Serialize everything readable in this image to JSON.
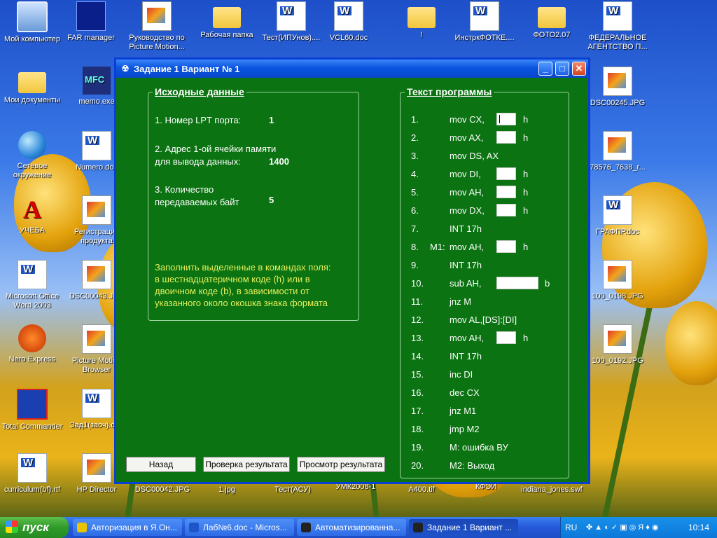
{
  "desktop_icons": [
    {
      "label": "Мой компьютер",
      "icon": "computer-icon"
    },
    {
      "label": "FAR manager",
      "icon": "far-manager-icon"
    },
    {
      "label": "Руководство по Picture Motion...",
      "icon": "picture-motion-icon"
    },
    {
      "label": "Рабочая папка",
      "icon": "folder-icon"
    },
    {
      "label": "Тест(ИПУнов)....",
      "icon": "word-doc-icon"
    },
    {
      "label": "VCL60.doc",
      "icon": "word-doc-icon"
    },
    {
      "label": "!",
      "icon": "folder-icon"
    },
    {
      "label": "ИнстркФОТКЕ....",
      "icon": "word-doc-icon"
    },
    {
      "label": "ФОТО2.07",
      "icon": "folder-icon"
    },
    {
      "label": "ФЕДЕРАЛЬНОЕ АГЕНТСТВО П...",
      "icon": "word-doc-icon"
    },
    {
      "label": "Мои документы",
      "icon": "my-documents-icon"
    },
    {
      "label": "memo.exe",
      "icon": "memo-exe-icon"
    },
    {
      "label": "Сетевое окружение",
      "icon": "network-icon"
    },
    {
      "label": "Numero.doc",
      "icon": "word-doc-icon"
    },
    {
      "label": "УЧЕБА",
      "icon": "acrobat-icon"
    },
    {
      "label": "Регистрация продукта",
      "icon": "camera-icon"
    },
    {
      "label": "Microsoft Office Word 2003",
      "icon": "word-app-icon"
    },
    {
      "label": "DSC00043.JPG",
      "icon": "image-file-icon"
    },
    {
      "label": "Nero Express",
      "icon": "nero-icon"
    },
    {
      "label": "Picture Motion Browser",
      "icon": "picture-browser-icon"
    },
    {
      "label": "Total Commander",
      "icon": "floppy-icon"
    },
    {
      "label": "Зад1(заоч).doc",
      "icon": "word-doc-icon"
    },
    {
      "label": "curriculum(bf).rtf",
      "icon": "word-doc-icon"
    },
    {
      "label": "HP Director",
      "icon": "hp-director-icon"
    },
    {
      "label": "DSC00042.JPG",
      "icon": "image-file-icon"
    },
    {
      "label": "1.jpg",
      "icon": "image-file-icon"
    },
    {
      "label": "Тест(АСУ)",
      "icon": "word-doc-icon"
    },
    {
      "label": "УМК2008-1",
      "icon": "folder-icon"
    },
    {
      "label": "A400.tif",
      "icon": "image-file-icon"
    },
    {
      "label": "КФЭИ",
      "icon": "folder-icon"
    },
    {
      "label": "indiana_jones.swf",
      "icon": "flash-file-icon"
    },
    {
      "label": "DSC00245.JPG",
      "icon": "image-file-icon"
    },
    {
      "label": "78576_7638_r...",
      "icon": "image-file-icon"
    },
    {
      "label": "ГРАФПР.doc",
      "icon": "word-doc-icon"
    },
    {
      "label": "100_0198.JPG",
      "icon": "image-file-icon"
    },
    {
      "label": "100_0192.JPG",
      "icon": "image-file-icon"
    }
  ],
  "window": {
    "title": "Задание 1  Вариант № 1",
    "title_icon": "radiation-icon",
    "minimize": "_",
    "maximize": "□",
    "close": "✕"
  },
  "source_data": {
    "title": "Исходные данные",
    "lpt_label": "1. Номер LPT порта:",
    "lpt_value": "1",
    "addr_label_1": "2. Адрес 1-ой ячейки памяти",
    "addr_label_2": "для вывода данных:",
    "addr_value": "1400",
    "count_label_1": "3. Количество",
    "count_label_2": "передаваемых байт",
    "count_value": "5",
    "note_1": "Заполнить выделенные в командах поля:",
    "note_2": "в шестнадцатеричном коде (h) или в",
    "note_3": "двоичном коде (b), в зависимости от",
    "note_4": "указанного около окошка знака формата"
  },
  "program": {
    "title": "Текст программы",
    "lines": [
      {
        "num": "1.",
        "text": "mov  CX,",
        "box": "narrow",
        "suffix": "h"
      },
      {
        "num": "2.",
        "text": "mov  AX,",
        "box": "narrow",
        "suffix": "h"
      },
      {
        "num": "3.",
        "text": "mov  DS, AX",
        "box": "",
        "suffix": ""
      },
      {
        "num": "4.",
        "text": "mov  DI,",
        "box": "narrow",
        "suffix": "h"
      },
      {
        "num": "5.",
        "text": "mov  AH,",
        "box": "narrow",
        "suffix": "h"
      },
      {
        "num": "6.",
        "text": "mov  DX,",
        "box": "narrow",
        "suffix": "h"
      },
      {
        "num": "7.",
        "text": "INT 17h",
        "box": "",
        "suffix": ""
      },
      {
        "num": "8.",
        "label": "M1:",
        "text": "mov  AH,",
        "box": "narrow",
        "suffix": "h"
      },
      {
        "num": "9.",
        "text": "INT 17h",
        "box": "",
        "suffix": ""
      },
      {
        "num": "10.",
        "text": "sub  AH,",
        "box": "wide",
        "suffix": "b"
      },
      {
        "num": "11.",
        "text": "jnz M",
        "box": "",
        "suffix": ""
      },
      {
        "num": "12.",
        "text": "mov  AL,[DS]:[DI]",
        "box": "",
        "suffix": ""
      },
      {
        "num": "13.",
        "text": "mov  AH,",
        "box": "narrow",
        "suffix": "h"
      },
      {
        "num": "14.",
        "text": "INT 17h",
        "box": "",
        "suffix": ""
      },
      {
        "num": "15.",
        "text": "inc DI",
        "box": "",
        "suffix": ""
      },
      {
        "num": "16.",
        "text": "dec CX",
        "box": "",
        "suffix": ""
      },
      {
        "num": "17.",
        "text": "jnz M1",
        "box": "",
        "suffix": ""
      },
      {
        "num": "18.",
        "text": "jmp M2",
        "box": "",
        "suffix": ""
      },
      {
        "num": "19.",
        "text": "M: ошибка ВУ",
        "box": "",
        "suffix": ""
      },
      {
        "num": "20.",
        "text": "M2: Выход",
        "box": "",
        "suffix": ""
      }
    ]
  },
  "buttons": {
    "back": "Назад",
    "check": "Проверка результата",
    "view": "Просмотр результата"
  },
  "taskbar": {
    "start": "пуск",
    "tasks": [
      {
        "label": "Авторизация в Я.Он...",
        "icon": "yandex-icon"
      },
      {
        "label": "Лаб№6.doc - Micros...",
        "icon": "word-doc-icon"
      },
      {
        "label": "Автоматизированна...",
        "icon": "radiation-icon"
      },
      {
        "label": "Задание 1  Вариант ...",
        "icon": "radiation-icon"
      }
    ],
    "lang": "RU",
    "clock": "10:14"
  }
}
